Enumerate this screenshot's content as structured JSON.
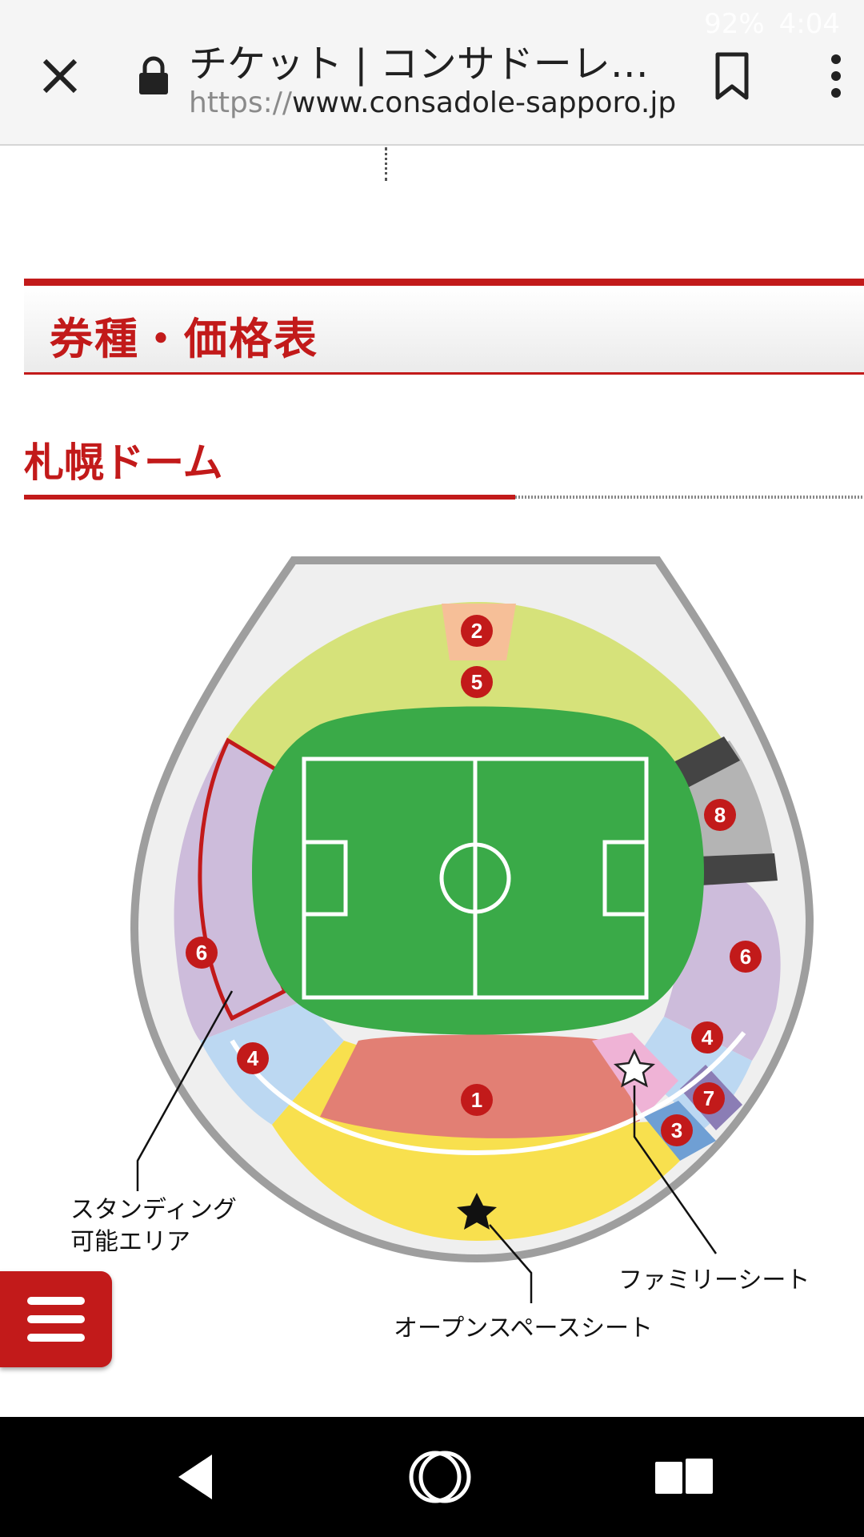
{
  "status": {
    "battery": "92%",
    "time": "4:04"
  },
  "browser": {
    "title": "チケット | コンサドーレ…",
    "url_scheme": "https://",
    "url_host": "www.consadole-sapporo.jp"
  },
  "page": {
    "section_title": "券種・価格表",
    "venue_title": "札幌ドーム"
  },
  "map": {
    "zones": [
      {
        "number": "1",
        "color": "#e27f74"
      },
      {
        "number": "2",
        "color": "#f6bf98"
      },
      {
        "number": "3",
        "color": "#6f9fd4"
      },
      {
        "number": "4",
        "color": "#bcd8f2"
      },
      {
        "number": "5",
        "color": "#d6e27a"
      },
      {
        "number": "6",
        "color": "#cdbcdb"
      },
      {
        "number": "7",
        "color": "#8b7db5"
      },
      {
        "number": "8",
        "color": "#b4b4b4"
      }
    ],
    "open_space_color": "#f8e04e",
    "family_color": "#efb3d6",
    "pitch_color": "#3aaa48",
    "annotations": {
      "standing_line1": "スタンディング",
      "standing_line2": "可能エリア",
      "family_seat": "ファミリーシート",
      "open_space_seat": "オープンスペースシート"
    }
  },
  "accent_color": "#c21a1a"
}
